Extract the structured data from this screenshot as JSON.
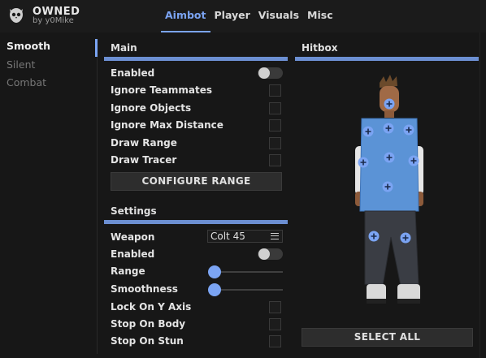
{
  "app": {
    "title": "OWNED",
    "subtitle": "by y0Mike"
  },
  "tabs": [
    {
      "label": "Aimbot",
      "active": true
    },
    {
      "label": "Player",
      "active": false
    },
    {
      "label": "Visuals",
      "active": false
    },
    {
      "label": "Misc",
      "active": false
    }
  ],
  "sidebar": {
    "items": [
      {
        "label": "Smooth",
        "active": true
      },
      {
        "label": "Silent",
        "active": false
      },
      {
        "label": "Combat",
        "active": false
      }
    ]
  },
  "main": {
    "title": "Main",
    "enabled_label": "Enabled",
    "enabled_on": false,
    "ignore_teammates_label": "Ignore Teammates",
    "ignore_objects_label": "Ignore Objects",
    "ignore_max_distance_label": "Ignore Max Distance",
    "draw_range_label": "Draw Range",
    "draw_tracer_label": "Draw Tracer",
    "configure_range_label": "CONFIGURE RANGE"
  },
  "settings": {
    "title": "Settings",
    "weapon_label": "Weapon",
    "weapon_value": "Colt 45",
    "enabled_label": "Enabled",
    "enabled_on": false,
    "range_label": "Range",
    "range_value": 0,
    "smoothness_label": "Smoothness",
    "smoothness_value": 0,
    "lock_y_label": "Lock On Y Axis",
    "stop_body_label": "Stop On Body",
    "stop_stun_label": "Stop On Stun"
  },
  "hitbox": {
    "title": "Hitbox",
    "select_all_label": "SELECT ALL"
  },
  "colors": {
    "accent": "#7ba4f3",
    "background": "#171717",
    "button": "#2d2d2d"
  },
  "icons": {
    "logo": "owl-logo-icon",
    "hitbox_point": "crosshair-plus-icon",
    "weapon_select": "hamburger-menu-icon"
  }
}
